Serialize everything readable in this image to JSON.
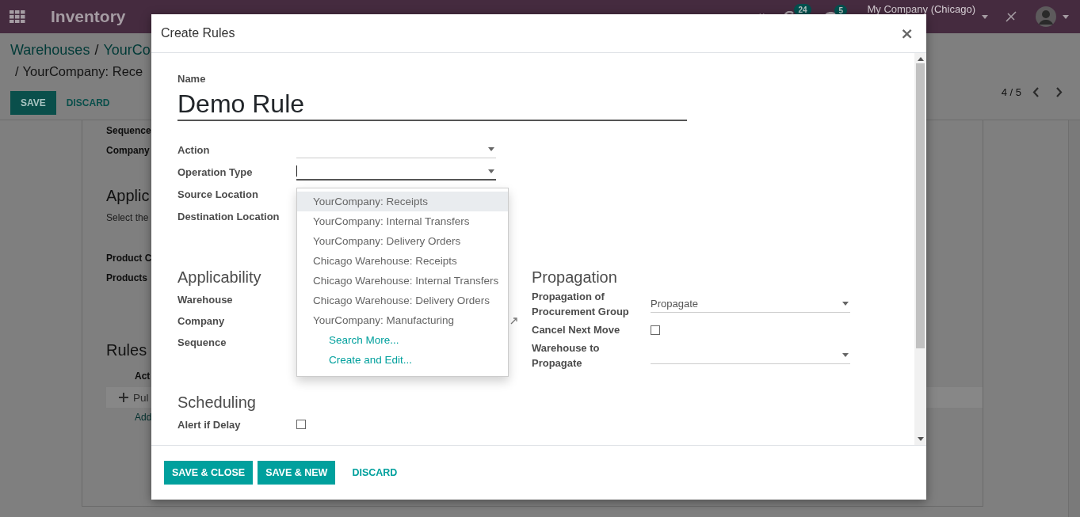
{
  "navbar": {
    "app_title": "Inventory",
    "activity_badge": "24",
    "message_badge": "5",
    "company": "My Company (Chicago)"
  },
  "control_panel": {
    "breadcrumb": [
      {
        "text": "Warehouses",
        "kind": "link"
      },
      {
        "text": "YourCo",
        "kind": "link"
      },
      {
        "text": "YourCompany: Rece",
        "kind": "current"
      }
    ],
    "separator": "/",
    "buttons": [
      {
        "label": "SAVE",
        "kind": "primary"
      },
      {
        "label": "DISCARD",
        "kind": "link"
      }
    ],
    "pager": "4 / 5"
  },
  "sheet": {
    "fields_top": [
      "Sequence",
      "Company"
    ],
    "section_title": "Applic",
    "section_hint": "Select the",
    "fields_mid": [
      "Product C",
      "Products"
    ],
    "rules_title": "Rules",
    "rules_header": "Act",
    "rules_row": "Pul",
    "add_line": "Add"
  },
  "dialog": {
    "title": "Create Rules",
    "close_symbol": "×",
    "name_label": "Name",
    "name_value": "Demo Rule",
    "main_fields": [
      {
        "label": "Action",
        "kind": "select",
        "focused": false
      },
      {
        "label": "Operation Type",
        "kind": "select",
        "focused": true
      },
      {
        "label": "Source Location",
        "kind": "covered"
      },
      {
        "label": "Destination Location",
        "kind": "covered"
      }
    ],
    "groups": [
      {
        "title": "Applicability",
        "fields": [
          {
            "label": "Warehouse",
            "kind": "covered"
          },
          {
            "label": "Company",
            "kind": "covered_link"
          },
          {
            "label": "Sequence",
            "kind": "covered"
          }
        ]
      },
      {
        "title": "Propagation",
        "fields": [
          {
            "label": "Propagation of Procurement Group",
            "kind": "select",
            "value": "Propagate",
            "focused": false
          },
          {
            "label": "Cancel Next Move",
            "kind": "checkbox",
            "checked": false
          },
          {
            "label": "Warehouse to Propagate",
            "kind": "select",
            "focused": false
          }
        ]
      }
    ],
    "scheduling": {
      "title": "Scheduling",
      "fields": [
        {
          "label": "Alert if Delay",
          "kind": "checkbox",
          "checked": false
        }
      ]
    },
    "dropdown": {
      "options": [
        {
          "text": "YourCompany: Receipts",
          "selected": true
        },
        {
          "text": "YourCompany: Internal Transfers",
          "selected": false
        },
        {
          "text": "YourCompany: Delivery Orders",
          "selected": false
        },
        {
          "text": "Chicago Warehouse: Receipts",
          "selected": false
        },
        {
          "text": "Chicago Warehouse: Internal Transfers",
          "selected": false
        },
        {
          "text": "Chicago Warehouse: Delivery Orders",
          "selected": false
        },
        {
          "text": "YourCompany: Manufacturing",
          "selected": false
        }
      ],
      "actions": [
        "Search More...",
        "Create and Edit..."
      ]
    },
    "footer_buttons": [
      {
        "label": "SAVE & CLOSE",
        "kind": "primary"
      },
      {
        "label": "SAVE & NEW",
        "kind": "primary"
      },
      {
        "label": "DISCARD",
        "kind": "link"
      }
    ]
  }
}
